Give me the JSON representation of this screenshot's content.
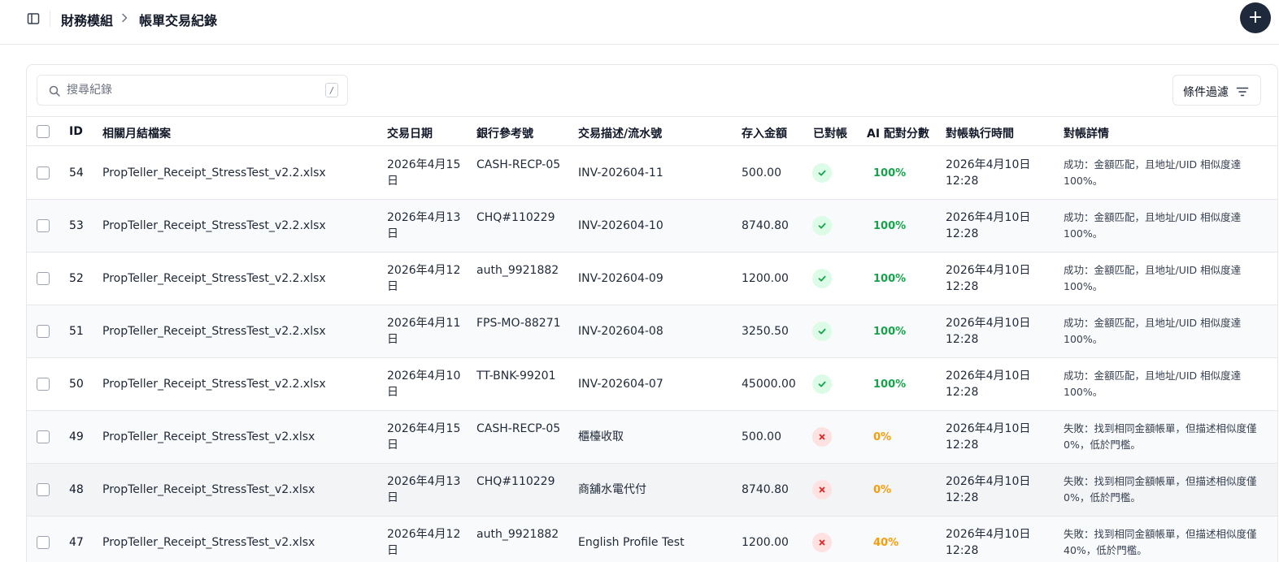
{
  "header": {
    "breadcrumb_parent": "財務模組",
    "breadcrumb_current": "帳單交易紀錄",
    "add_label": "+"
  },
  "toolbar": {
    "search_placeholder": "搜尋紀錄",
    "search_shortcut": "/",
    "filter_label": "條件過濾"
  },
  "table": {
    "columns": [
      "ID",
      "相關月結檔案",
      "交易日期",
      "銀行參考號",
      "交易描述/流水號",
      "存入金額",
      "已對帳",
      "AI 配對分數",
      "對帳執行時間",
      "對帳詳情"
    ],
    "rows": [
      {
        "id": "54",
        "file": "PropTeller_Receipt_StressTest_v2.2.xlsx",
        "date": "2026年4月15日",
        "ref": "CASH-RECP-05",
        "desc": "INV-202604-11",
        "amount": "500.00",
        "reconciled": "success",
        "score": "100%",
        "exec_time": "2026年4月10日 12:28",
        "detail": "成功：金額匹配，且地址/UID 相似度達 100%。"
      },
      {
        "id": "53",
        "file": "PropTeller_Receipt_StressTest_v2.2.xlsx",
        "date": "2026年4月13日",
        "ref": "CHQ#110229",
        "desc": "INV-202604-10",
        "amount": "8740.80",
        "reconciled": "success",
        "score": "100%",
        "exec_time": "2026年4月10日 12:28",
        "detail": "成功：金額匹配，且地址/UID 相似度達 100%。"
      },
      {
        "id": "52",
        "file": "PropTeller_Receipt_StressTest_v2.2.xlsx",
        "date": "2026年4月12日",
        "ref": "auth_9921882",
        "desc": "INV-202604-09",
        "amount": "1200.00",
        "reconciled": "success",
        "score": "100%",
        "exec_time": "2026年4月10日 12:28",
        "detail": "成功：金額匹配，且地址/UID 相似度達 100%。"
      },
      {
        "id": "51",
        "file": "PropTeller_Receipt_StressTest_v2.2.xlsx",
        "date": "2026年4月11日",
        "ref": "FPS-MO-88271",
        "desc": "INV-202604-08",
        "amount": "3250.50",
        "reconciled": "success",
        "score": "100%",
        "exec_time": "2026年4月10日 12:28",
        "detail": "成功：金額匹配，且地址/UID 相似度達 100%。"
      },
      {
        "id": "50",
        "file": "PropTeller_Receipt_StressTest_v2.2.xlsx",
        "date": "2026年4月10日",
        "ref": "TT-BNK-99201",
        "desc": "INV-202604-07",
        "amount": "45000.00",
        "reconciled": "success",
        "score": "100%",
        "exec_time": "2026年4月10日 12:28",
        "detail": "成功：金額匹配，且地址/UID 相似度達 100%。"
      },
      {
        "id": "49",
        "file": "PropTeller_Receipt_StressTest_v2.xlsx",
        "date": "2026年4月15日",
        "ref": "CASH-RECP-05",
        "desc": "櫃檯收取",
        "amount": "500.00",
        "reconciled": "failed",
        "score": "0%",
        "exec_time": "2026年4月10日 12:28",
        "detail": "失敗：找到相同金額帳單，但描述相似度僅 0%，低於門檻。"
      },
      {
        "id": "48",
        "file": "PropTeller_Receipt_StressTest_v2.xlsx",
        "date": "2026年4月13日",
        "ref": "CHQ#110229",
        "desc": "商舖水電代付",
        "amount": "8740.80",
        "reconciled": "failed",
        "score": "0%",
        "exec_time": "2026年4月10日 12:28",
        "detail": "失敗：找到相同金額帳單，但描述相似度僅 0%，低於門檻。"
      },
      {
        "id": "47",
        "file": "PropTeller_Receipt_StressTest_v2.xlsx",
        "date": "2026年4月12日",
        "ref": "auth_9921882",
        "desc": "English Profile Test",
        "amount": "1200.00",
        "reconciled": "failed",
        "score": "40%",
        "exec_time": "2026年4月10日 12:28",
        "detail": "失敗：找到相同金額帳單，但描述相似度僅 40%，低於門檻。"
      }
    ]
  },
  "colors": {
    "success": "#16a34a",
    "success_bg": "#dcfce7",
    "fail": "#dc2626",
    "fail_bg": "#fee2e2",
    "warn": "#f59e0b",
    "accent": "#1e293b"
  },
  "icons": {
    "sidebar_toggle": "sidebar-icon",
    "breadcrumb_separator": "chevron-right-icon",
    "search": "search-icon",
    "filter": "filter-icon",
    "success": "check-icon",
    "failed": "x-icon"
  }
}
